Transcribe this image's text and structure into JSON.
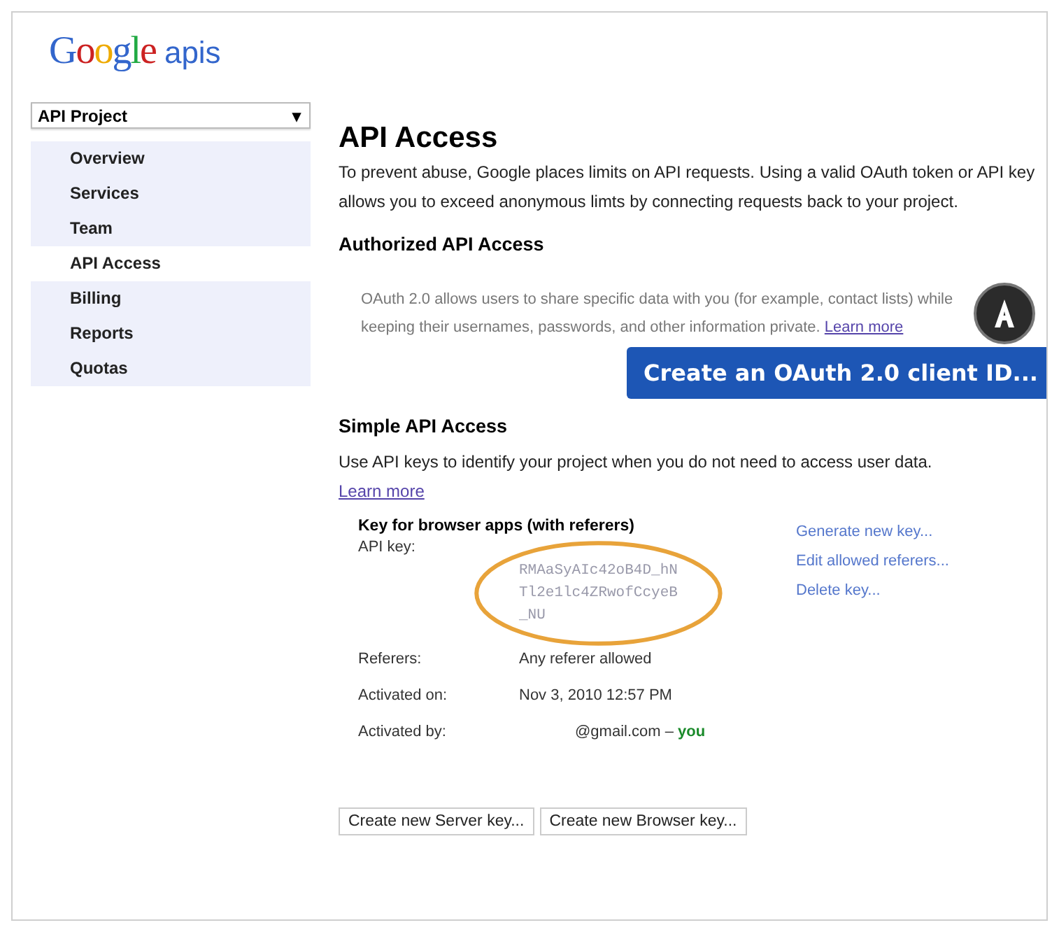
{
  "logo": {
    "letters": [
      "G",
      "o",
      "o",
      "g",
      "l",
      "e"
    ],
    "suffix": "apis"
  },
  "project_select": {
    "value": "API Project",
    "caret": "▾"
  },
  "sidebar": {
    "items": [
      {
        "label": "Overview",
        "selected": false
      },
      {
        "label": "Services",
        "selected": false
      },
      {
        "label": "Team",
        "selected": false
      },
      {
        "label": "API Access",
        "selected": true
      },
      {
        "label": "Billing",
        "selected": false
      },
      {
        "label": "Reports",
        "selected": false
      },
      {
        "label": "Quotas",
        "selected": false
      }
    ]
  },
  "main": {
    "title": "API Access",
    "intro": "To prevent abuse, Google places limits on API requests. Using a valid OAuth token or API key allows you to exceed anonymous limts by connecting requests back to your project.",
    "authorized": {
      "heading": "Authorized API Access",
      "text": "OAuth 2.0 allows users to share specific data with you (for example, contact lists) while keeping their usernames, passwords, and other information private.",
      "link": "Learn more",
      "button": "Create an OAuth 2.0 client ID..."
    },
    "simple": {
      "heading": "Simple API Access",
      "text": "Use API keys to identify your project when you do not need to access user data.",
      "link": "Learn more",
      "key": {
        "heading": "Key for browser apps (with referers)",
        "rows": [
          {
            "label": "API key:",
            "kind": "key",
            "value_lines": [
              "RMAaSyAIc42oB4D_hN",
              "Tl2e1lc4ZRwofCcyeB",
              "_NU"
            ]
          },
          {
            "label": "Referers:",
            "kind": "text",
            "value": "Any referer allowed"
          },
          {
            "label": "Activated on:",
            "kind": "text",
            "value": "Nov 3, 2010 12:57 PM"
          },
          {
            "label": "Activated by:",
            "kind": "user",
            "value": "@gmail.com",
            "separator": "–",
            "badge": "you"
          }
        ],
        "actions": [
          "Generate new key...",
          "Edit allowed referers...",
          "Delete key..."
        ]
      },
      "buttons": [
        "Create new Server key...",
        "Create new Browser key..."
      ]
    }
  }
}
